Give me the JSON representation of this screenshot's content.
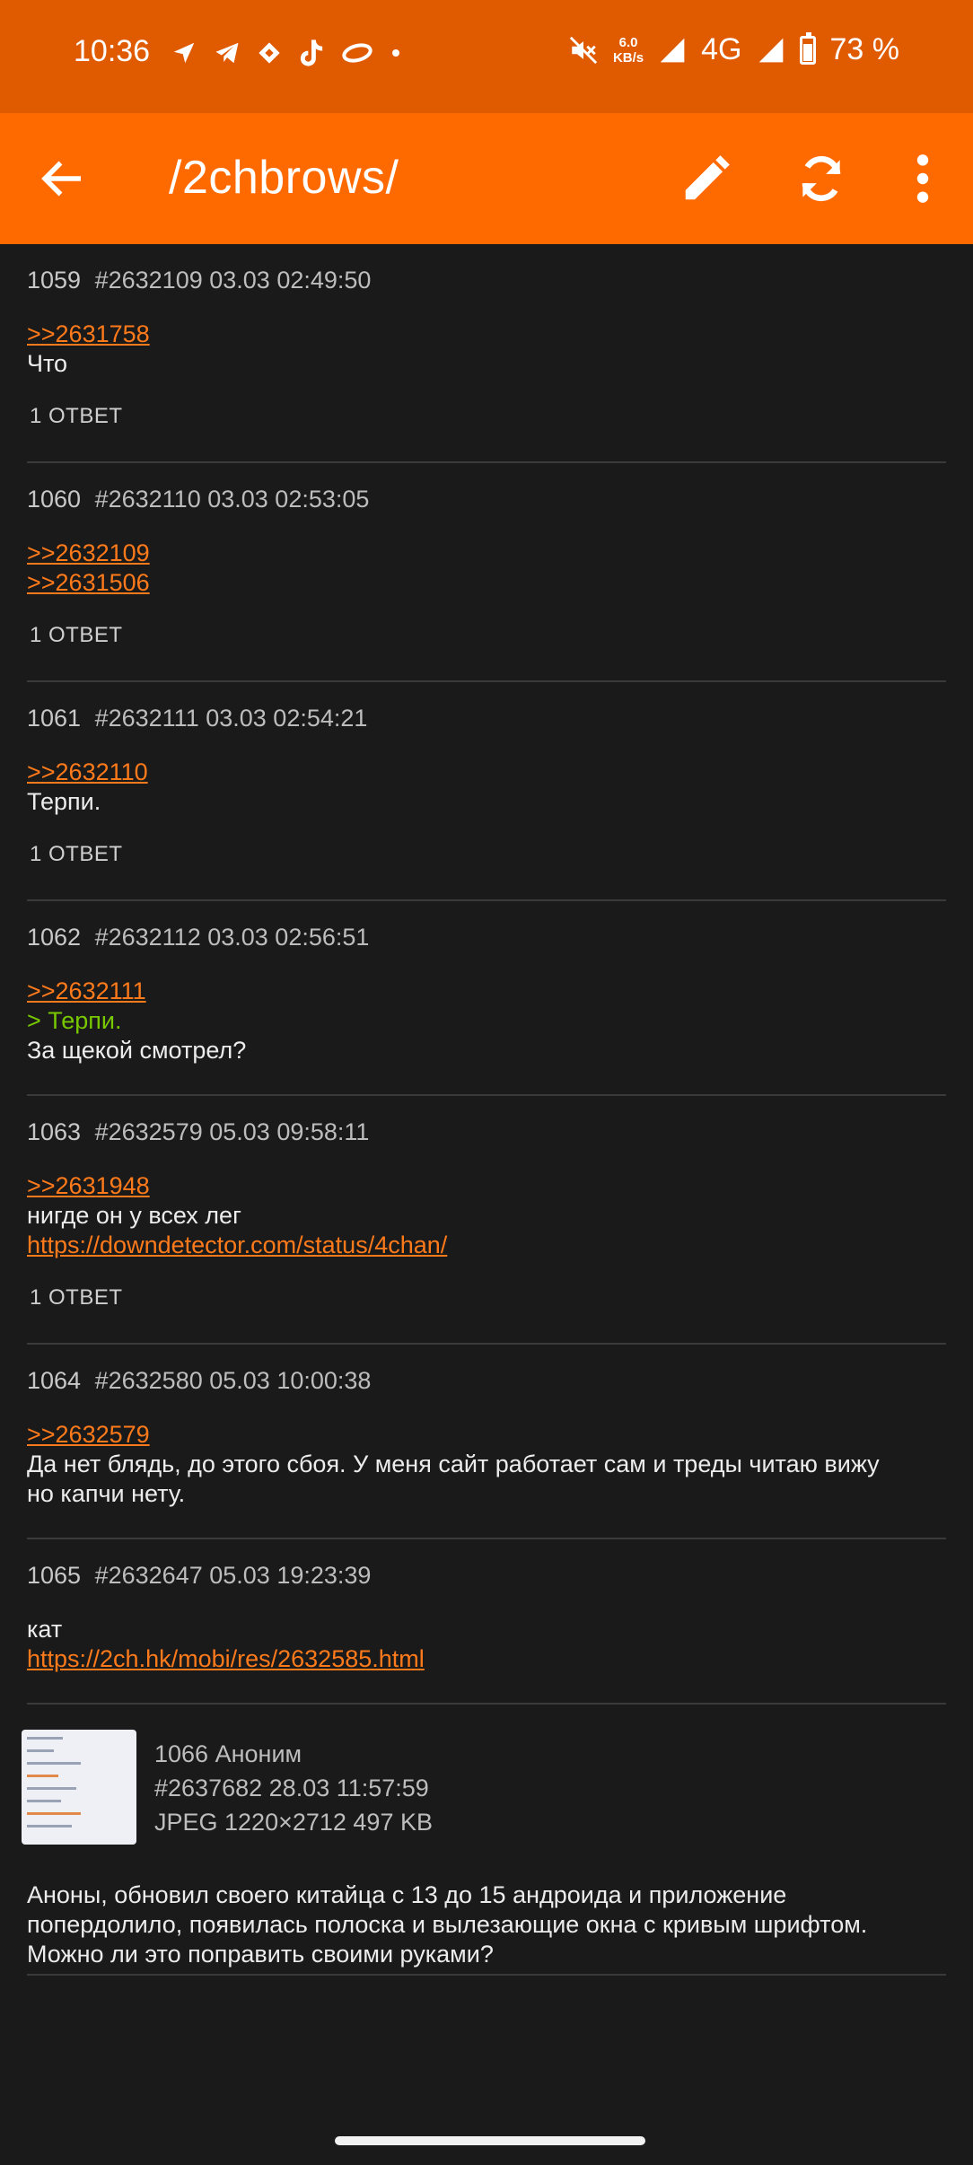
{
  "status_bar": {
    "time": "10:36",
    "net_speed_value": "6.0",
    "net_speed_unit": "KB/s",
    "network": "4G",
    "battery": "73 %",
    "icons": [
      "navigation-icon",
      "telegram-icon",
      "diamond-icon",
      "tiktok-icon",
      "ring-icon",
      "dot-icon",
      "mute-icon",
      "signal-icon",
      "battery-icon"
    ]
  },
  "toolbar": {
    "title": "/2chbrows/",
    "back_icon": "arrow-left-icon",
    "edit_icon": "pencil-icon",
    "refresh_icon": "refresh-icon",
    "more_icon": "more-vert-icon"
  },
  "posts": [
    {
      "num": "1059",
      "id": "#2632109",
      "date": "03.03 02:49:50",
      "lines": [
        {
          "t": ">>2631758",
          "k": "link"
        },
        {
          "t": "Что",
          "k": "text"
        }
      ],
      "replies": "1 ОТВЕТ"
    },
    {
      "num": "1060",
      "id": "#2632110",
      "date": "03.03 02:53:05",
      "lines": [
        {
          "t": ">>2632109",
          "k": "link"
        },
        {
          "t": ">>2631506",
          "k": "link"
        }
      ],
      "replies": "1 ОТВЕТ"
    },
    {
      "num": "1061",
      "id": "#2632111",
      "date": "03.03 02:54:21",
      "lines": [
        {
          "t": ">>2632110",
          "k": "link"
        },
        {
          "t": "Терпи.",
          "k": "text"
        }
      ],
      "replies": "1 ОТВЕТ"
    },
    {
      "num": "1062",
      "id": "#2632112",
      "date": "03.03 02:56:51",
      "lines": [
        {
          "t": ">>2632111",
          "k": "link"
        },
        {
          "t": "> Терпи.",
          "k": "quote"
        },
        {
          "t": "За щекой смотрел?",
          "k": "text"
        }
      ],
      "replies": ""
    },
    {
      "num": "1063",
      "id": "#2632579",
      "date": "05.03 09:58:11",
      "lines": [
        {
          "t": ">>2631948",
          "k": "link"
        },
        {
          "t": "нигде он у всех лег",
          "k": "text"
        },
        {
          "t": "https://downdetector.com/status/4chan/",
          "k": "link"
        }
      ],
      "replies": "1 ОТВЕТ"
    },
    {
      "num": "1064",
      "id": "#2632580",
      "date": "05.03 10:00:38",
      "lines": [
        {
          "t": ">>2632579",
          "k": "link"
        },
        {
          "t": "Да нет блядь, до этого сбоя. У меня сайт работает сам и треды читаю вижу",
          "k": "text"
        },
        {
          "t": "но капчи нету.",
          "k": "text"
        }
      ],
      "replies": ""
    },
    {
      "num": "1065",
      "id": "#2632647",
      "date": "05.03 19:23:39",
      "lines": [
        {
          "t": "кат",
          "k": "text"
        },
        {
          "t": "https://2ch.hk/mobi/res/2632585.html",
          "k": "link"
        }
      ],
      "replies": ""
    }
  ],
  "last_post": {
    "num": "1066",
    "author": "Аноним",
    "id": "#2637682",
    "date": "28.03 11:57:59",
    "file_info": "JPEG 1220×2712 497 KB",
    "text": [
      "Аноны, обновил своего китайца с 13 до 15 андроида и приложение",
      "попердолило, появилась полоска и вылезающие окна с кривым шрифтом.",
      "Можно ли это поправить своими руками?"
    ]
  }
}
